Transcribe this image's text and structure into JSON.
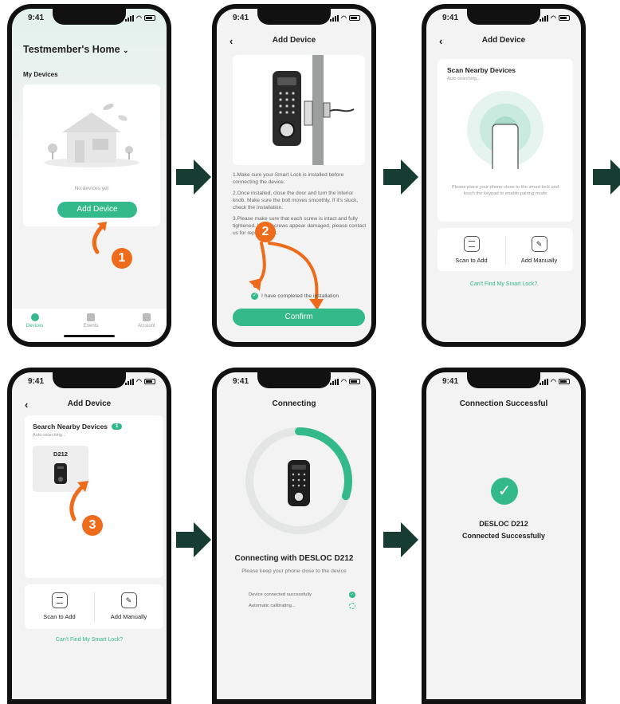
{
  "status_time": "9:41",
  "screen1": {
    "home_title": "Testmember's Home",
    "section": "My Devices",
    "empty_text": "No devices yet",
    "add_button": "Add Device",
    "step": "1",
    "tabs": [
      "Devices",
      "Events",
      "Account"
    ]
  },
  "screen2": {
    "title": "Add Device",
    "instructions": [
      "1.Make sure your Smart Lock is installed before connecting the device.",
      "2.Once installed, close the door and turn the interior knob. Make sure the bolt moves smoothly. If it's stuck, check the installation.",
      "3.Please make sure that each screw is intact and fully tightened. If any screws appear damaged, please contact us for replacement."
    ],
    "step": "2",
    "checkbox_label": "I have completed the installation",
    "confirm": "Confirm"
  },
  "screen3": {
    "title": "Add Device",
    "card_title": "Scan Nearby Devices",
    "card_sub": "Auto-searching...",
    "hint": "Please place your phone close to the smart lock and touch the keypad to enable pairing mode",
    "scan_to_add": "Scan to Add",
    "add_manually": "Add Manually",
    "cant_find": "Can't Find My Smart Lock?"
  },
  "screen4": {
    "title": "Add Device",
    "card_title": "Search Nearby Devices",
    "badge": "1",
    "card_sub": "Auto-searching...",
    "device_name": "D212",
    "step": "3",
    "scan_to_add": "Scan to Add",
    "add_manually": "Add Manually",
    "cant_find": "Can't Find My Smart Lock?"
  },
  "screen5": {
    "title": "Connecting",
    "heading": "Connecting with DESLOC D212",
    "sub": "Please keep your phone close to the device",
    "progress_fraction": 0.3,
    "step1": "Device connected successfully",
    "step2": "Automatic calibrating..."
  },
  "screen6": {
    "title": "Connection Successful",
    "line1": "DESLOC D212",
    "line2": "Connected Successfully"
  },
  "colors": {
    "accent": "#33b98a",
    "step_badge": "#ee6b1b",
    "flow_arrow": "#173d33"
  }
}
